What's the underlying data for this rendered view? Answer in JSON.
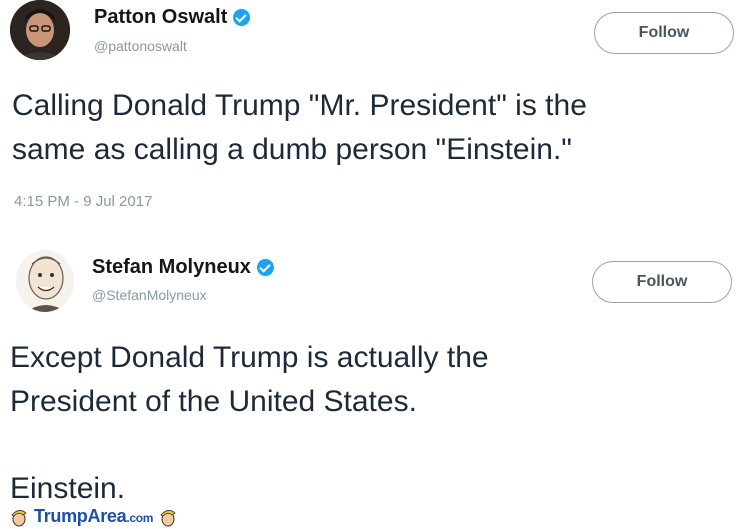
{
  "tweets": [
    {
      "display_name": "Patton Oswalt",
      "handle": "@pattonoswalt",
      "follow_label": "Follow",
      "text": "Calling Donald Trump \"Mr. President\" is the\nsame as calling a dumb person \"Einstein.\"",
      "timestamp": "4:15 PM - 9 Jul 2017",
      "verified": true
    },
    {
      "display_name": "Stefan Molyneux",
      "handle": "@StefanMolyneux",
      "follow_label": "Follow",
      "text": "Except Donald Trump is actually the\nPresident of the United States.\n\nEinstein.",
      "verified": true
    }
  ],
  "watermark": {
    "text": "TrumpArea",
    "suffix": ".com"
  },
  "colors": {
    "verified": "#1da1f2",
    "text": "#1c2938",
    "muted": "#8899a6",
    "watermark": "#1d4fa8"
  }
}
